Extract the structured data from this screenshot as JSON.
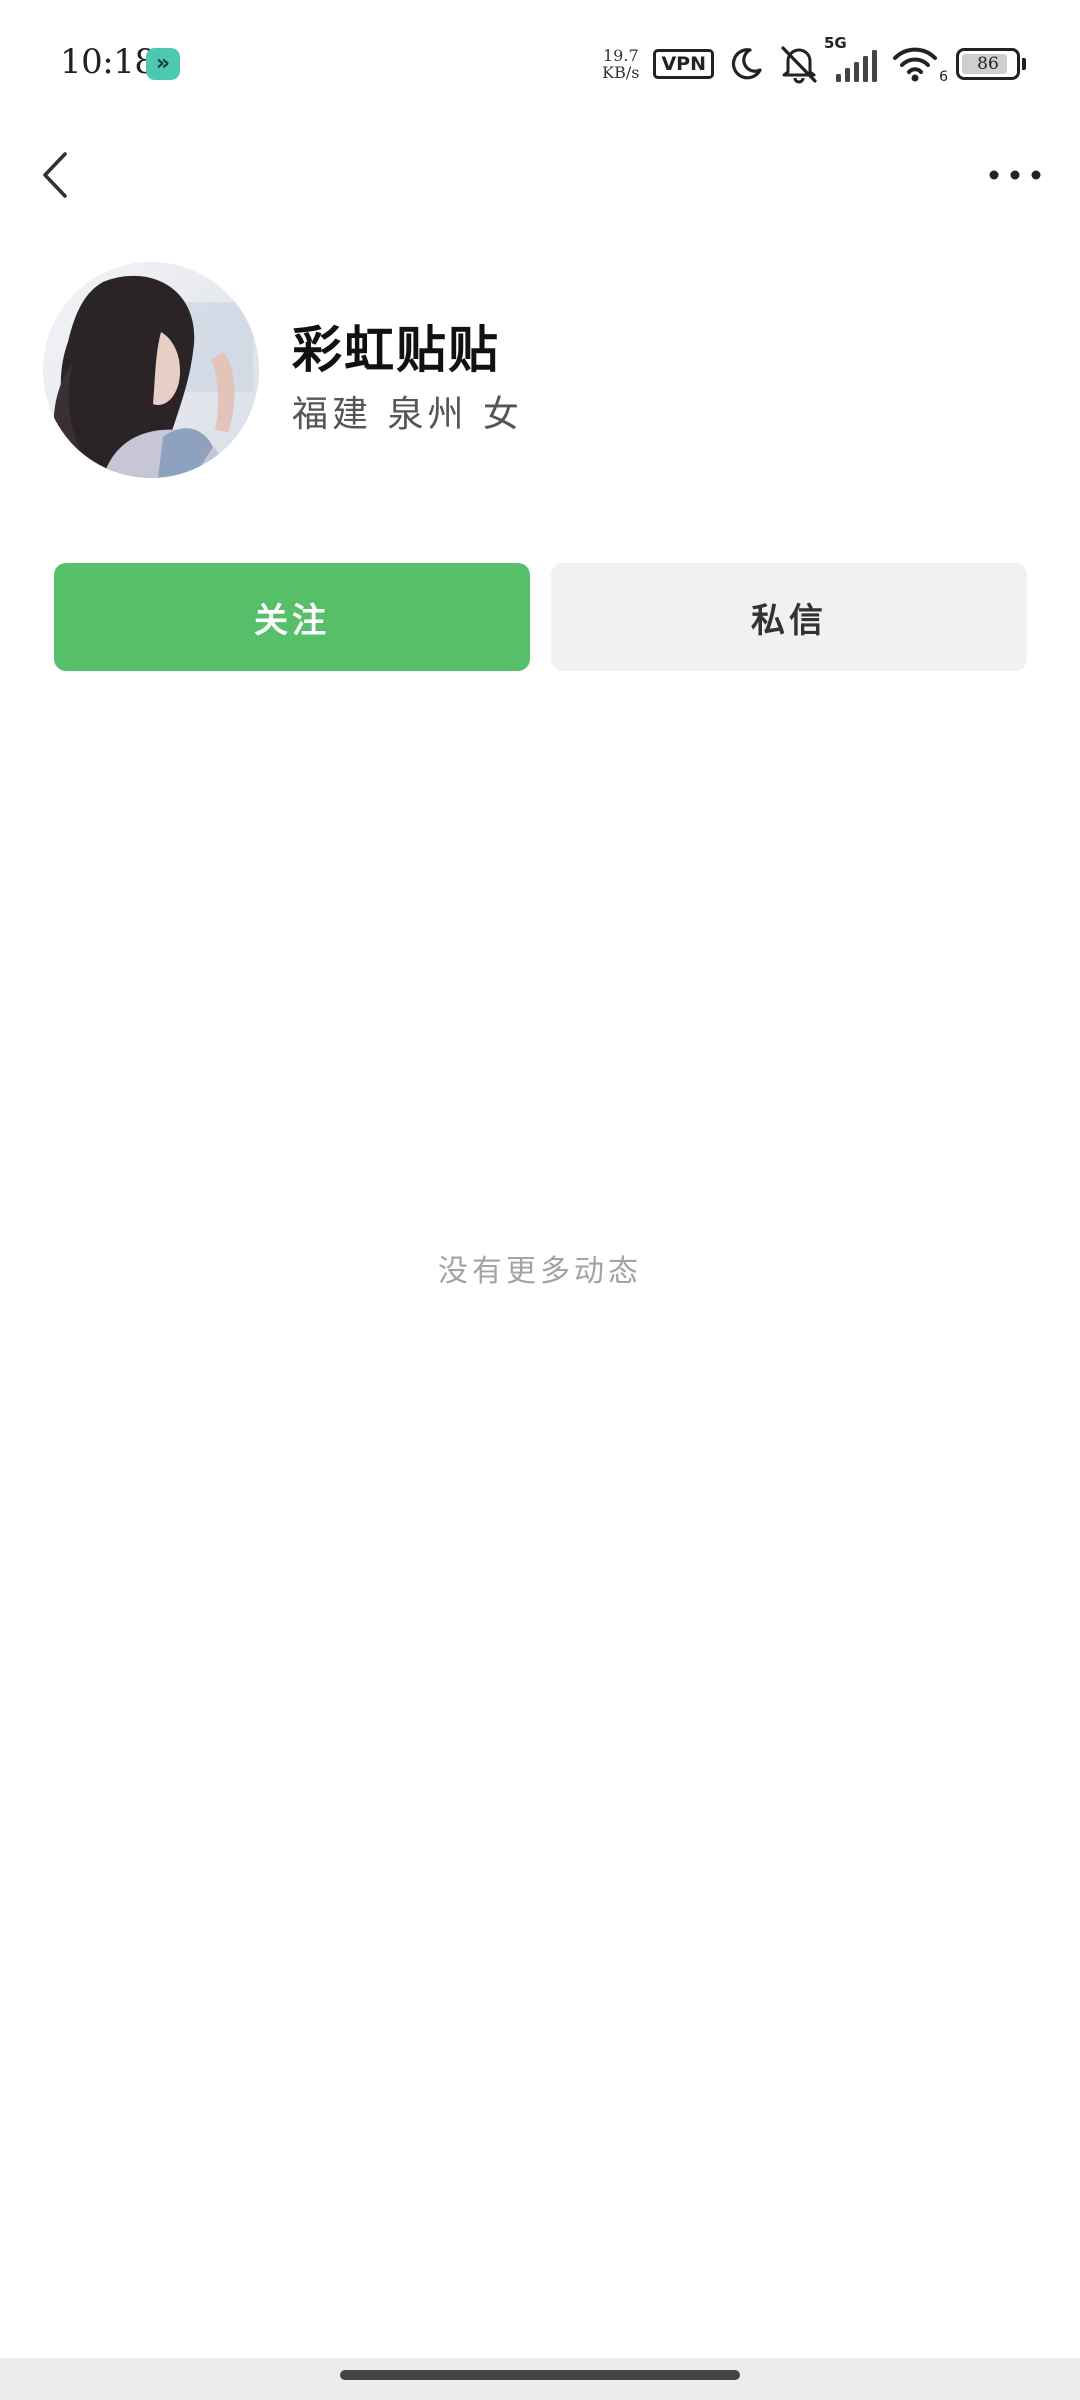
{
  "status_bar": {
    "time": "10:18",
    "app_icon_glyph": "»",
    "net_speed_value": "19.7",
    "net_speed_unit": "KB/s",
    "vpn_label": "VPN",
    "network_label": "5G",
    "wifi_label": "6",
    "battery_level": "86",
    "battery_fraction": 0.86,
    "icons": [
      "app-shortcut-icon",
      "vpn-icon",
      "moon-icon",
      "mute-icon",
      "signal-icon",
      "wifi-icon",
      "battery-icon"
    ]
  },
  "nav": {
    "back_icon": "chevron-left-icon",
    "more_icon": "more-horizontal-icon"
  },
  "profile": {
    "name": "彩虹贴贴",
    "location": "福建 泉州 女"
  },
  "actions": {
    "follow_label": "关注",
    "message_label": "私信"
  },
  "feed": {
    "empty_text": "没有更多动态"
  },
  "colors": {
    "follow_button": "#57be6a",
    "message_button": "#f1f1f1",
    "app_icon": "#4cc9b0",
    "empty_text": "#a3a3a3"
  }
}
